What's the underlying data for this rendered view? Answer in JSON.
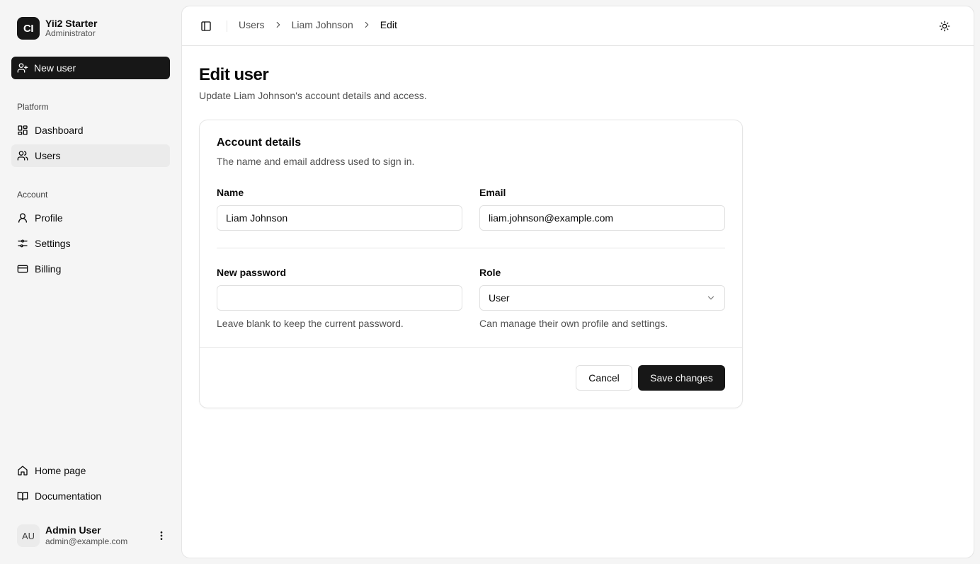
{
  "brand": {
    "logo_text": "CI",
    "title": "Yii2 Starter",
    "subtitle": "Administrator"
  },
  "sidebar": {
    "new_user_label": "New user",
    "sections": [
      {
        "label": "Platform",
        "items": [
          {
            "label": "Dashboard",
            "icon": "dashboard-icon",
            "active": false
          },
          {
            "label": "Users",
            "icon": "users-icon",
            "active": true
          }
        ]
      },
      {
        "label": "Account",
        "items": [
          {
            "label": "Profile",
            "icon": "user-icon",
            "active": false
          },
          {
            "label": "Settings",
            "icon": "sliders-icon",
            "active": false
          },
          {
            "label": "Billing",
            "icon": "credit-card-icon",
            "active": false
          }
        ]
      }
    ],
    "footer_links": [
      {
        "label": "Home page",
        "icon": "home-icon"
      },
      {
        "label": "Documentation",
        "icon": "book-icon"
      }
    ],
    "user": {
      "initials": "AU",
      "name": "Admin User",
      "email": "admin@example.com"
    }
  },
  "breadcrumb": [
    "Users",
    "Liam Johnson",
    "Edit"
  ],
  "page": {
    "title": "Edit user",
    "subtitle": "Update Liam Johnson's account details and access."
  },
  "card": {
    "title": "Account details",
    "description": "The name and email address used to sign in.",
    "fields": {
      "name": {
        "label": "Name",
        "value": "Liam Johnson"
      },
      "email": {
        "label": "Email",
        "value": "liam.johnson@example.com"
      },
      "password": {
        "label": "New password",
        "value": "",
        "hint": "Leave blank to keep the current password."
      },
      "role": {
        "label": "Role",
        "value": "User",
        "hint": "Can manage their own profile and settings."
      }
    },
    "cancel_label": "Cancel",
    "save_label": "Save changes"
  }
}
